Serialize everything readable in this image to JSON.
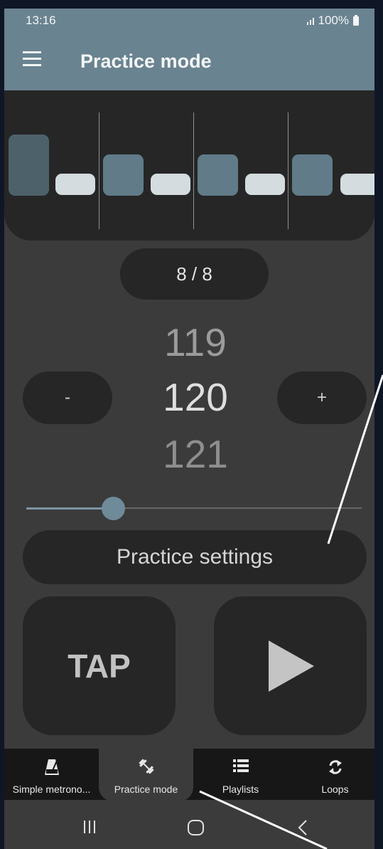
{
  "status_bar": {
    "time": "13:16",
    "battery": "100%"
  },
  "app_bar": {
    "title": "Practice mode"
  },
  "beats": [
    {
      "type": "accent-high"
    },
    {
      "type": "off"
    },
    {
      "type": "accent"
    },
    {
      "type": "off"
    },
    {
      "type": "accent"
    },
    {
      "type": "off"
    },
    {
      "type": "accent"
    },
    {
      "type": "off"
    }
  ],
  "bar_counter": "8 / 8",
  "tempo": {
    "previous": "119",
    "current": "120",
    "next": "121",
    "slider_fraction": 0.26
  },
  "controls": {
    "decrease_label": "-",
    "increase_label": "+",
    "practice_settings_label": "Practice settings",
    "tap_label": "TAP"
  },
  "bottom_nav": {
    "items": [
      {
        "label": "Simple metrono...",
        "icon": "metronome-icon",
        "active": false
      },
      {
        "label": "Practice mode",
        "icon": "dumbbell-icon",
        "active": true
      },
      {
        "label": "Playlists",
        "icon": "list-icon",
        "active": false
      },
      {
        "label": "Loops",
        "icon": "loop-icon",
        "active": false
      }
    ]
  },
  "colors": {
    "app_bar": "#6a8390",
    "background": "#3b3b3b",
    "surface": "#262626",
    "accent": "#617b88",
    "beat_off": "#d4dcdf"
  }
}
